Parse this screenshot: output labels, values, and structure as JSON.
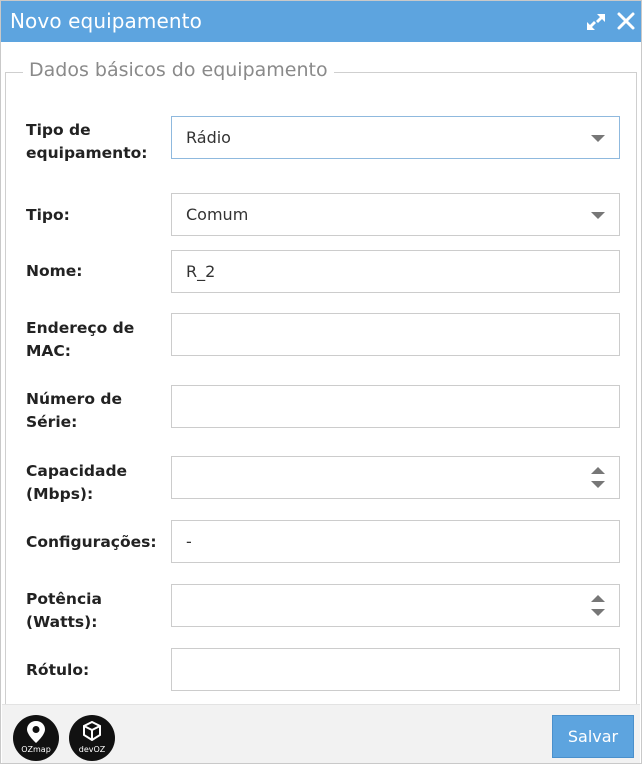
{
  "window": {
    "title": "Novo equipamento"
  },
  "section": {
    "legend": "Dados básicos do equipamento"
  },
  "form": {
    "tipo_equipamento": {
      "label": "Tipo de\nequipamento:",
      "value": "Rádio"
    },
    "tipo": {
      "label": "Tipo:",
      "value": "Comum"
    },
    "nome": {
      "label": "Nome:",
      "value": "R_2"
    },
    "mac": {
      "label": "Endereço de\nMAC:",
      "value": ""
    },
    "serie": {
      "label": "Número de\nSérie:",
      "value": ""
    },
    "capacidade": {
      "label": "Capacidade\n(Mbps):",
      "value": ""
    },
    "configuracoes": {
      "label": "Configurações:",
      "value": "-"
    },
    "potencia": {
      "label": "Potência\n(Watts):",
      "value": ""
    },
    "rotulo": {
      "label": "Rótulo:",
      "value": ""
    }
  },
  "footer": {
    "logo_ozmap": {
      "icon": "ozmap-logo-icon",
      "text": "OZmap"
    },
    "logo_devoz": {
      "icon": "devoz-logo-icon",
      "text": "devOZ"
    },
    "save_label": "Salvar"
  },
  "colors": {
    "accent": "#5da4df",
    "label": "#222222",
    "legend": "#8a8a8a"
  }
}
